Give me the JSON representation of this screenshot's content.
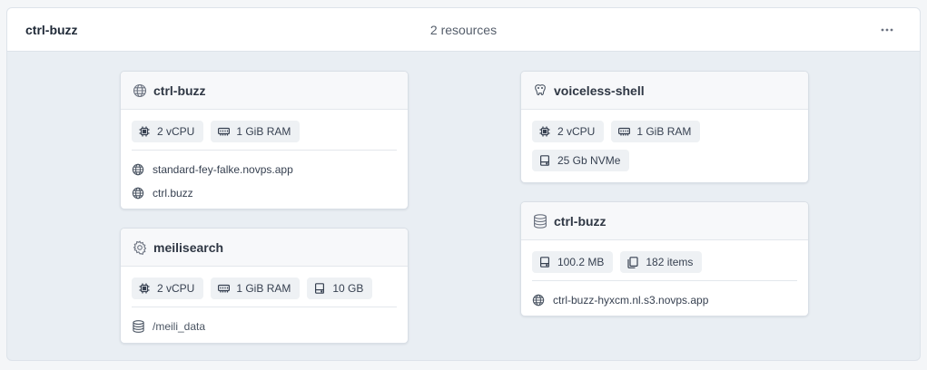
{
  "project": {
    "name": "ctrl-buzz",
    "resource_count": "2 resources",
    "more_icon": "more-horizontal-icon"
  },
  "cards": {
    "app": {
      "title": "ctrl-buzz",
      "icon": "globe-icon",
      "cpu": "2 vCPU",
      "ram": "1 GiB RAM",
      "domains": [
        "standard-fey-falke.novps.app",
        "ctrl.buzz"
      ]
    },
    "meili": {
      "title": "meilisearch",
      "icon": "gear-icon",
      "cpu": "2 vCPU",
      "ram": "1 GiB RAM",
      "disk": "10 GB",
      "volume": "/meili_data"
    },
    "postgres": {
      "title": "voiceless-shell",
      "icon": "postgres-elephant-icon",
      "cpu": "2 vCPU",
      "ram": "1 GiB RAM",
      "disk": "25 Gb NVMe"
    },
    "bucket": {
      "title": "ctrl-buzz",
      "icon": "database-icon",
      "size": "100.2 MB",
      "items": "182 items",
      "endpoint": "ctrl-buzz-hyxcm.nl.s3.novps.app"
    }
  },
  "colors": {
    "canvas": "#e9eef3",
    "card": "#ffffff",
    "card_header": "#f7f8fa",
    "chip": "#eef1f4",
    "text": "#1f2937",
    "muted": "#555e6b",
    "icon": "#5b6472"
  }
}
